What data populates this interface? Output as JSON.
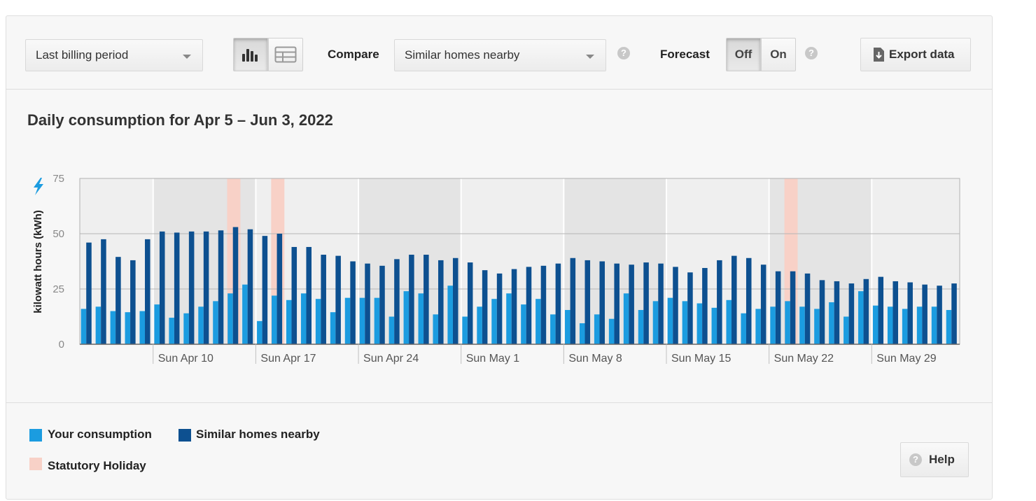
{
  "toolbar": {
    "period_select": "Last billing period",
    "compare_label": "Compare",
    "compare_select": "Similar homes nearby",
    "forecast_label": "Forecast",
    "forecast_off": "Off",
    "forecast_on": "On",
    "forecast_selected": "Off",
    "view_selected": "bar-chart",
    "export_label": "Export data",
    "help_glyph": "?"
  },
  "legend": {
    "your": "Your consumption",
    "similar": "Similar homes nearby",
    "holiday": "Statutory Holiday"
  },
  "help_label": "Help",
  "colors": {
    "your": "#1b9ce0",
    "similar": "#0d5090",
    "holiday": "#f8d1c7",
    "bolt": "#1b9ce0"
  },
  "chart_data": {
    "type": "bar",
    "title": "Daily consumption for Apr 5 – Jun 3, 2022",
    "ylabel": "kilowatt hours (kWh)",
    "ylim": [
      0,
      75
    ],
    "yticks": [
      0,
      25,
      50,
      75
    ],
    "start_date": "2022-04-05",
    "xtick_labels": [
      "Sun Apr 10",
      "Sun Apr 17",
      "Sun Apr 24",
      "Sun May 1",
      "Sun May 8",
      "Sun May 15",
      "Sun May 22",
      "Sun May 29"
    ],
    "holidays": [
      "2022-04-15",
      "2022-04-18",
      "2022-05-23"
    ],
    "series": [
      {
        "name": "Your consumption",
        "values": [
          16,
          17,
          15,
          14.5,
          15,
          18,
          12,
          14,
          17,
          19.5,
          23,
          27,
          10.5,
          22,
          20,
          23,
          20.5,
          14.5,
          21,
          21,
          21,
          12.5,
          24,
          23,
          13.5,
          26.5,
          12.5,
          17,
          20.5,
          23,
          18,
          20.5,
          13.5,
          15.5,
          9.5,
          13.5,
          11.5,
          23,
          15.5,
          19.5,
          21,
          19.5,
          18.5,
          16.5,
          20,
          14,
          16,
          17,
          19.5,
          17,
          16,
          19,
          12.5,
          24,
          17.5,
          17,
          16,
          17,
          17,
          15.5
        ]
      },
      {
        "name": "Similar homes nearby",
        "values": [
          46,
          47.5,
          39.5,
          38,
          47.5,
          51,
          50.5,
          51,
          51,
          51.5,
          53,
          52,
          49,
          50,
          44,
          44,
          40.5,
          40,
          37.5,
          36.5,
          35.5,
          38.5,
          40.5,
          40.5,
          38,
          39,
          37,
          33.5,
          32,
          34,
          35,
          35.5,
          36.5,
          39,
          38,
          37.5,
          36.5,
          36,
          37,
          36.5,
          35,
          32.5,
          34.5,
          38,
          40,
          39,
          36,
          33,
          33,
          32,
          29,
          28.5,
          27.5,
          29.5,
          30.5,
          28.5,
          28,
          27,
          26.5,
          27.5
        ]
      }
    ]
  }
}
